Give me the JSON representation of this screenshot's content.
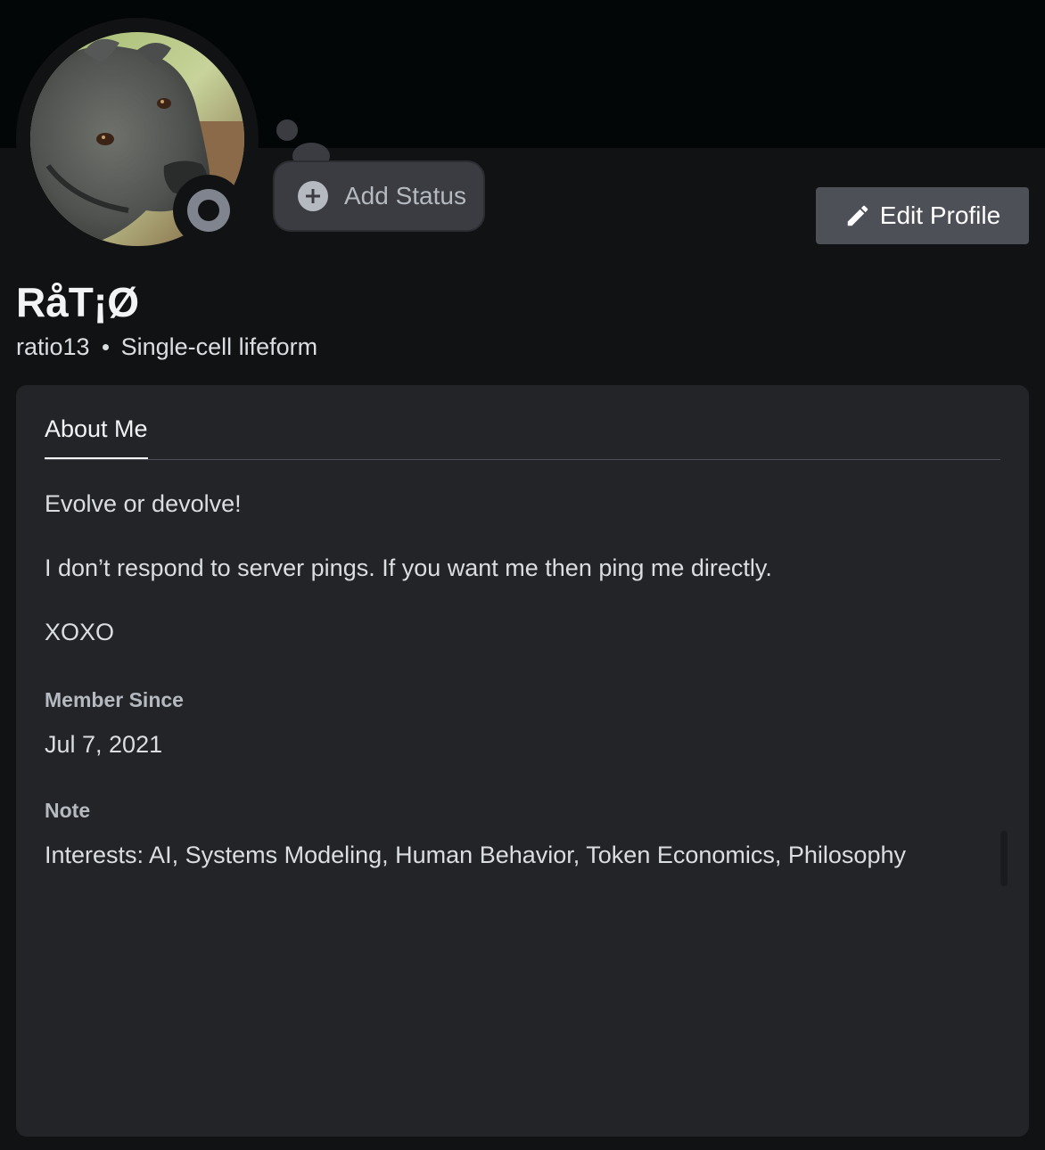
{
  "profile": {
    "display_name": "RåT¡Ø",
    "username": "ratio13",
    "pronouns": "Single-cell lifeform",
    "add_status_label": "Add Status",
    "edit_profile_label": "Edit Profile",
    "presence_status": "offline",
    "presence_color": "#80848e"
  },
  "tabs": [
    {
      "label": "About Me",
      "active": true
    }
  ],
  "about": {
    "lines": [
      "Evolve or devolve!",
      "I don’t respond to server pings. If you want me then ping me directly.",
      "XOXO"
    ]
  },
  "member_since": {
    "label": "Member Since",
    "value": "Jul 7, 2021"
  },
  "note": {
    "label": "Note",
    "value": "Interests: AI, Systems Modeling, Human Behavior, Token Economics, Philosophy"
  },
  "icons": {
    "add_status": "plus-circle-icon",
    "edit_profile": "pencil-icon",
    "presence": "offline-status-icon"
  },
  "colors": {
    "background": "#111214",
    "banner": "#030607",
    "card": "#232428",
    "button": "#4e5058"
  }
}
